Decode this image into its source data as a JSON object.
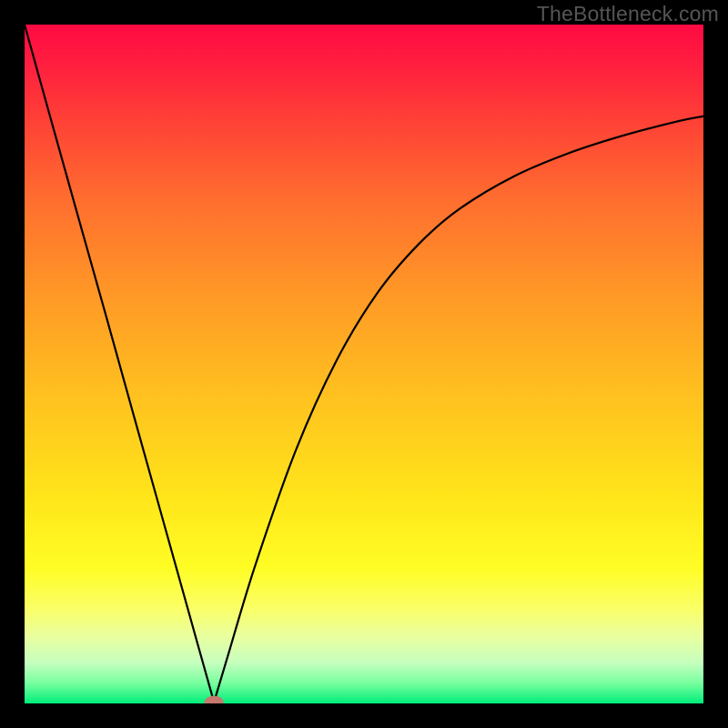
{
  "watermark": "TheBottleneck.com",
  "chart_data": {
    "type": "line",
    "title": "",
    "xlabel": "",
    "ylabel": "",
    "xlim": [
      0,
      100
    ],
    "ylim": [
      0,
      100
    ],
    "grid": false,
    "legend": false,
    "series": [
      {
        "name": "curve",
        "x": [
          0,
          4,
          8,
          12,
          16,
          20,
          24,
          27.9,
          28,
          30,
          34,
          40,
          46,
          52,
          58,
          64,
          72,
          80,
          88,
          96,
          100
        ],
        "y": [
          100,
          85.6,
          71.3,
          57.1,
          42.7,
          28.4,
          14.1,
          0.2,
          0.5,
          7.2,
          20.4,
          37.4,
          50.6,
          60.5,
          67.6,
          72.8,
          77.6,
          81.0,
          83.6,
          85.7,
          86.5
        ]
      }
    ],
    "marker": {
      "x": 27.9,
      "y": 0.2,
      "rx": 1.4,
      "ry": 0.9,
      "color": "#c6776e"
    },
    "background_gradient": {
      "stops": [
        {
          "pos": 0.0,
          "color": "#ff0a42"
        },
        {
          "pos": 0.14,
          "color": "#ff4036"
        },
        {
          "pos": 0.4,
          "color": "#ff9926"
        },
        {
          "pos": 0.7,
          "color": "#ffe61a"
        },
        {
          "pos": 0.9,
          "color": "#eaff9e"
        },
        {
          "pos": 1.0,
          "color": "#00ee7a"
        }
      ]
    }
  }
}
